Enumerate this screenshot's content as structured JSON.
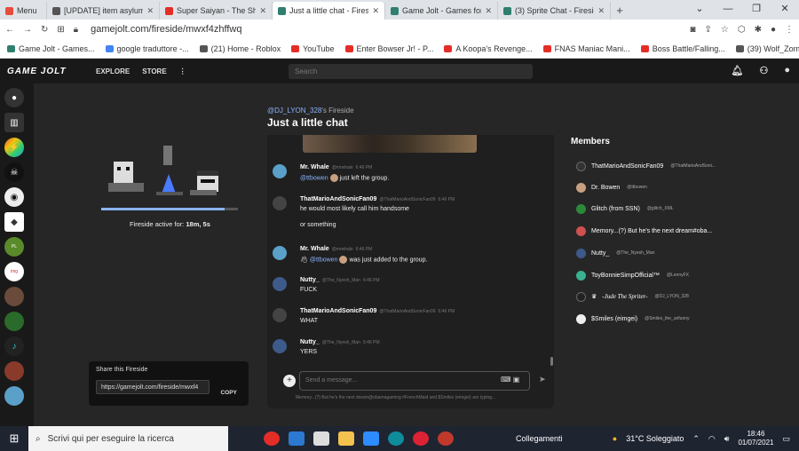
{
  "browser": {
    "tabs": [
      {
        "label": "Menu",
        "color": "#e74c3c"
      },
      {
        "label": "[UPDATE] item asylum - Ro",
        "color": "#444"
      },
      {
        "label": "Super Saiyan - The Shaggy",
        "color": "#e52d27"
      },
      {
        "label": "Just a little chat - Fireside",
        "color": "#2f7f6f"
      },
      {
        "label": "Game Jolt - Games for the",
        "color": "#2f7f6f"
      },
      {
        "label": "(3) Sprite Chat - Fireside -",
        "color": "#2f7f6f"
      }
    ],
    "new_tab": "+",
    "url": "gamejolt.com/fireside/mwxf4zhffwq",
    "bookmarks": [
      {
        "label": "Game Jolt - Games...",
        "color": "#2f7f6f"
      },
      {
        "label": "google traduttore -...",
        "color": "#4285f4"
      },
      {
        "label": "(21) Home - Roblox",
        "color": "#555"
      },
      {
        "label": "YouTube",
        "color": "#e52d27"
      },
      {
        "label": "Enter Bowser Jr! - P...",
        "color": "#e52d27"
      },
      {
        "label": "A Koopa's Revenge...",
        "color": "#e52d27"
      },
      {
        "label": "FNAS Maniac Mani...",
        "color": "#e52d27"
      },
      {
        "label": "Boss Battle/Falling...",
        "color": "#e52d27"
      },
      {
        "label": "(39) Wolf_Zombie2...",
        "color": "#555"
      }
    ]
  },
  "header": {
    "logo": "GAME JOLT",
    "explore": "EXPLORE",
    "store": "STORE",
    "search_placeholder": "Search"
  },
  "fireside": {
    "active_label": "Fireside active for:",
    "active_time": "18m, 5s",
    "progress": 0.9,
    "share_title": "Share this Fireside",
    "share_url": "https://gamejolt.com/fireside/mwxf4",
    "copy": "COPY"
  },
  "chat": {
    "owner": "@DJ_LYON_328",
    "owner_suffix": "'s Fireside",
    "title": "Just a little chat",
    "messages": [
      {
        "user": "Mr. Whale",
        "handle": "@mrwhale",
        "time": "6:46 PM",
        "mention": "@ttbowen",
        "text": "just left the group.",
        "color": "#5aa0c8"
      },
      {
        "user": "ThatMarioAndSonicFan09",
        "handle": "@ThatMarioAndSonicFan09",
        "time": "6:46 PM",
        "text": "he would most likely call him handsome",
        "text2": "or something",
        "color": "#333"
      },
      {
        "user": "Mr. Whale",
        "handle": "@mrwhale",
        "time": "6:46 PM",
        "mention": "@ttbowen",
        "text": "was just added to the group.",
        "color": "#5aa0c8"
      },
      {
        "user": "Nutty_",
        "handle": "@The_Nyesh_Man",
        "time": "6:46 PM",
        "text": "FUCK",
        "color": "#3d5a8a"
      },
      {
        "user": "ThatMarioAndSonicFan09",
        "handle": "@ThatMarioAndSonicFan09",
        "time": "6:46 PM",
        "text": "WHAT",
        "color": "#333"
      },
      {
        "user": "Nutty_",
        "handle": "@The_Nyesh_Man",
        "time": "6:46 PM",
        "text": "YERS",
        "color": "#3d5a8a"
      }
    ],
    "input_placeholder": "Send a message...",
    "typing": "Memory...(?) But he's the next dream@obamagaming #FrenchMaid and $Smiles (eimgei) are typing..."
  },
  "members": {
    "title": "Members",
    "list": [
      {
        "name": "ThatMarioAndSonicFan09",
        "handle": "@ThatMarioAndSoni...",
        "color": "#333"
      },
      {
        "name": "Dr. Bowen",
        "handle": "@ttbowen",
        "color": "#c8a080"
      },
      {
        "name": "Glitch (from SSN)",
        "handle": "@glitch_XML",
        "color": "#2a8a3a"
      },
      {
        "name": "Memory...(?) But he's the next dream#oba...",
        "handle": "",
        "color": "#d05050"
      },
      {
        "name": "Nutty_",
        "handle": "@The_Nyesh_Man",
        "color": "#3d5a8a"
      },
      {
        "name": "ToyBonnieSimpOfficial™",
        "handle": "@LennyFX",
        "color": "#3ab090"
      },
      {
        "name": "-Jude The Spriter-",
        "handle": "@DJ_LYON_328",
        "color": "#222"
      },
      {
        "name": "$Smiles (eimgei)",
        "handle": "@Smiles_the_unfunny",
        "color": "#eee"
      }
    ]
  },
  "taskbar": {
    "search": "Scrivi qui per eseguire la ricerca",
    "network": "Collegamenti",
    "weather": "31°C  Soleggiato",
    "time": "18:46",
    "date": "01/07/2021"
  }
}
